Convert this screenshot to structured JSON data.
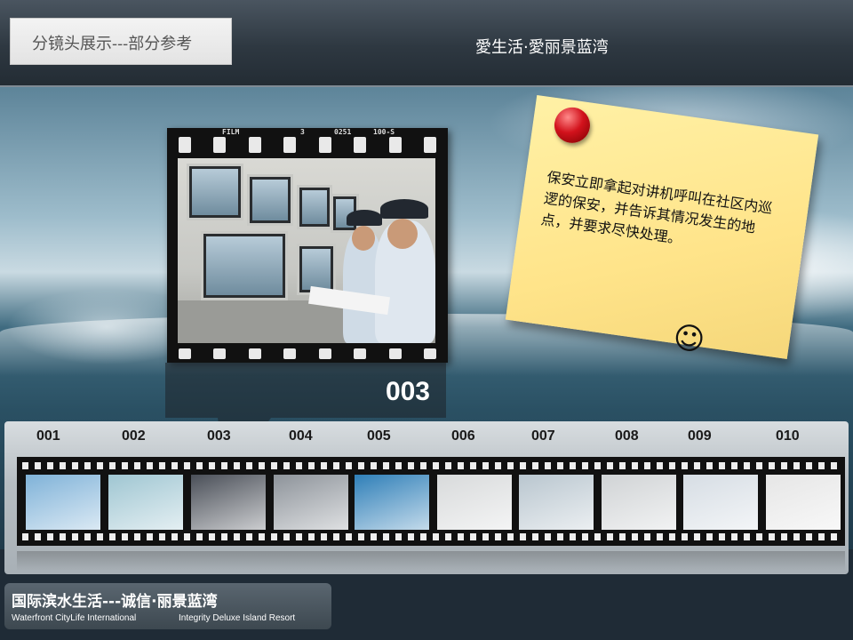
{
  "header": {
    "title": "分镜头展示---部分参考",
    "brand": "愛生活·愛丽景蓝湾"
  },
  "film_frame": {
    "label_film": "FILM",
    "label_num": "3",
    "label_code": "0251",
    "label_speed": "100-S",
    "current_number": "003",
    "scene_icon": "security-monitoring-photo"
  },
  "note": {
    "text": "保安立即拿起对讲机呼叫在社区内巡逻的保安，并告诉其情况发生的地点，并要求尽快处理。",
    "pin_icon": "red-pushpin-icon",
    "smile": "☺"
  },
  "filmstrip": {
    "frames": [
      {
        "label": "001",
        "icon": "open-door-sky-icon",
        "color": "#7fb2d8"
      },
      {
        "label": "002",
        "icon": "light-bulbs-icon",
        "color": "#9fc6d2"
      },
      {
        "label": "003",
        "icon": "business-people-icon",
        "color": "#4a4f58"
      },
      {
        "label": "004",
        "icon": "gears-icon",
        "color": "#8d939a"
      },
      {
        "label": "005",
        "icon": "water-drop-icon",
        "color": "#2f7fb8"
      },
      {
        "label": "006",
        "icon": "gear-man-icon",
        "color": "#d8dadb"
      },
      {
        "label": "007",
        "icon": "meeting-icon",
        "color": "#b9c6cf"
      },
      {
        "label": "008",
        "icon": "chart-pen-icon",
        "color": "#d0d3d5"
      },
      {
        "label": "009",
        "icon": "woman-growth-chart-icon",
        "color": "#d6dde4"
      },
      {
        "label": "010",
        "icon": "signature-pen-icon",
        "color": "#e6e6e6"
      }
    ]
  },
  "footer": {
    "title": "国际滨水生活---诚信·丽景蓝湾",
    "sub_left": "Waterfront CityLife International",
    "sub_right": "Integrity Deluxe Island  Resort"
  }
}
